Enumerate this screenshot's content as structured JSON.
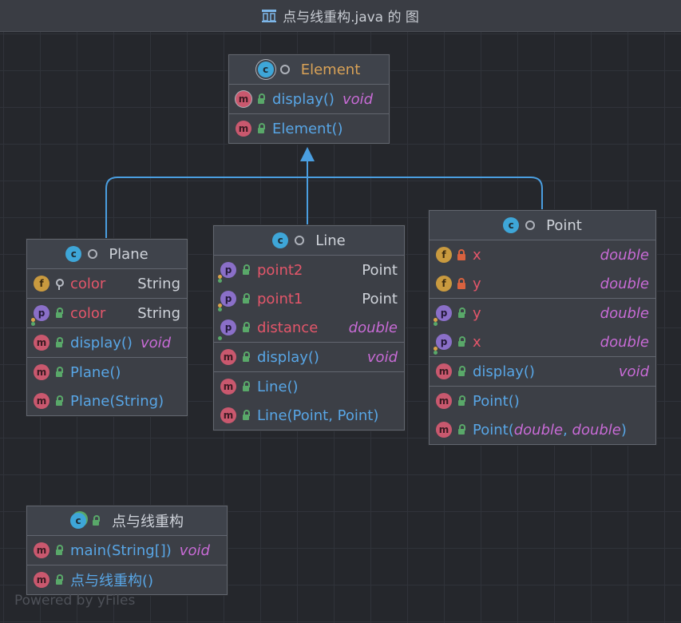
{
  "window": {
    "title": "点与线重构.java 的 图"
  },
  "colors": {
    "background": "#25272c",
    "edge": "#4a9ee0",
    "method_name": "#58a6e6",
    "field_name": "#e3566a",
    "type_italic": "#c86bd6"
  },
  "nodes": {
    "element": {
      "name": "Element",
      "members": [
        {
          "name": "display()",
          "type": "void"
        },
        {
          "name": "Element()"
        }
      ]
    },
    "plane": {
      "name": "Plane",
      "members": [
        {
          "name": "color",
          "type": "String"
        },
        {
          "name": "color",
          "type": "String"
        },
        {
          "name": "display()",
          "type": "void"
        },
        {
          "name": "Plane()"
        },
        {
          "name": "Plane(String)"
        }
      ]
    },
    "line": {
      "name": "Line",
      "members": [
        {
          "name": "point2",
          "type": "Point"
        },
        {
          "name": "point1",
          "type": "Point"
        },
        {
          "name": "distance",
          "type": "double"
        },
        {
          "name": "display()",
          "type": "void"
        },
        {
          "name": "Line()"
        },
        {
          "name": "Line(Point, Point)"
        }
      ]
    },
    "point": {
      "name": "Point",
      "members": [
        {
          "name": "x",
          "type": "double"
        },
        {
          "name": "y",
          "type": "double"
        },
        {
          "name": "y",
          "type": "double"
        },
        {
          "name": "x",
          "type": "double"
        },
        {
          "name": "display()",
          "type": "void"
        },
        {
          "name": "Point()"
        },
        {
          "name": "Point(",
          "arg1": "double",
          "sep": ", ",
          "arg2": "double",
          "close": ")"
        }
      ]
    },
    "main": {
      "name": "点与线重构",
      "members": [
        {
          "name": "main(String[])",
          "type": "void"
        },
        {
          "name": "点与线重构()"
        }
      ]
    }
  },
  "icons": {
    "class": "c",
    "method": "m",
    "field": "f",
    "property": "p",
    "title": "diagram-icon"
  },
  "watermark": "Powered by yFiles"
}
